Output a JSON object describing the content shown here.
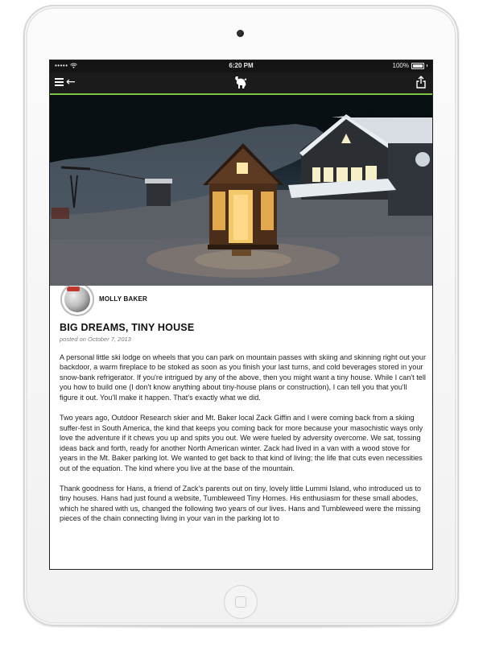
{
  "status_bar": {
    "signal": "•••••",
    "time": "6:20 PM",
    "battery": "100%"
  },
  "nav": {
    "menu_icon": "menu-icon",
    "back_icon": "back-arrow-icon",
    "logo_icon": "goat-logo-icon",
    "share_icon": "share-icon",
    "accent_color": "#7cc242"
  },
  "hero": {
    "alt": "Lit tiny house at night in snowy ski area parking lot with lodge and chairlift"
  },
  "article": {
    "author": "MOLLY BAKER",
    "title": "BIG DREAMS, TINY HOUSE",
    "posted_prefix": "posted on",
    "posted_date": "October 7, 2013",
    "paragraph_1": "A personal little ski lodge on wheels that you can park on mountain passes with skiing and skinning right out your backdoor, a warm fireplace to be stoked as soon as you finish your last turns, and cold beverages stored in your snow-bank refrigerator. If you're intrigued by any of the above, then you might want a tiny house. While I can't tell you how to build one (I don't know anything about tiny-house plans or construction), I can tell you that you'll figure it out. You'll make it happen. That's exactly what we did.",
    "paragraph_2a": "Two years ago,",
    "paragraph_2_link": "Outdoor Research",
    "paragraph_2b": "skier and Mt. Baker local Zack Giffin and I were coming back from a skiing suffer-fest in South America, the kind that keeps you coming back for more because your masochistic ways only love the adventure if it chews you up and spits you out. We were fueled by adversity overcome. We sat, tossing ideas back and forth, ready for another North American winter. Zack had lived in a van with a wood stove for years in the Mt. Baker parking lot. We wanted to get back to that kind of living; the life that cuts even necessities out of the equation. The kind where you live at the base of the mountain.",
    "paragraph_3": "Thank goodness for Hans, a friend of Zack's parents out on tiny, lovely little Lummi Island, who introduced us to tiny houses. Hans had just found a website, Tumbleweed Tiny Homes. His enthusiasm for these small abodes, which he shared with us, changed the following two years of our lives. Hans and Tumbleweed were the missing pieces of the chain connecting living in your van in the parking lot to"
  }
}
